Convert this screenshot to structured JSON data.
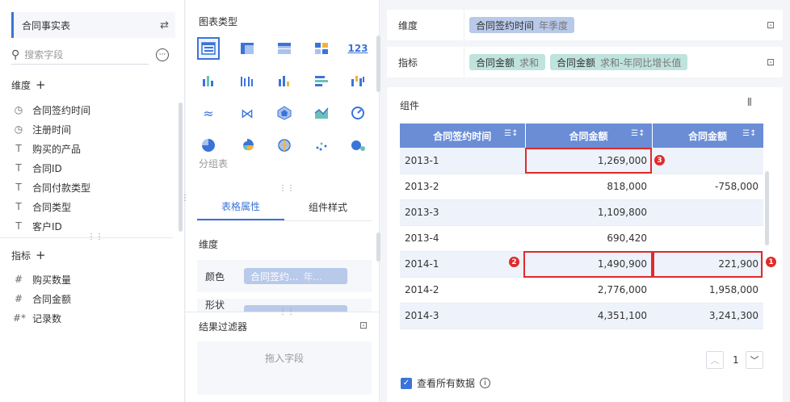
{
  "left": {
    "dataset": "合同事实表",
    "search_placeholder": "搜索字段",
    "dim_title": "维度",
    "dims": [
      {
        "icon": "clock-icon",
        "glyph": "◷",
        "label": "合同签约时间"
      },
      {
        "icon": "clock-icon",
        "glyph": "◷",
        "label": "注册时间"
      },
      {
        "icon": "text-type-icon",
        "glyph": "T",
        "label": "购买的产品"
      },
      {
        "icon": "text-type-icon",
        "glyph": "T",
        "label": "合同ID"
      },
      {
        "icon": "text-type-icon",
        "glyph": "T",
        "label": "合同付款类型"
      },
      {
        "icon": "text-type-icon",
        "glyph": "T",
        "label": "合同类型"
      },
      {
        "icon": "text-type-icon",
        "glyph": "T",
        "label": "客户ID"
      }
    ],
    "measure_title": "指标",
    "measures": [
      {
        "icon": "hash-icon",
        "glyph": "#",
        "label": "购买数量"
      },
      {
        "icon": "hash-icon",
        "glyph": "#",
        "label": "合同金额"
      },
      {
        "icon": "hash-star-icon",
        "glyph": "#*",
        "label": "记录数"
      }
    ]
  },
  "mid": {
    "chart_type_title": "图表类型",
    "group_label": "分组表",
    "tabs": [
      "表格属性",
      "组件样式"
    ],
    "dim_title": "维度",
    "color_label": "颜色",
    "color_pill": "合同签约...",
    "color_pill_sub": "年...",
    "shape_label": "形状",
    "filter_title": "结果过滤器",
    "drop_hint": "拖入字段"
  },
  "right": {
    "dim_label": "维度",
    "dim_pill": "合同签约时间",
    "dim_pill_sub": "年季度",
    "measure_label": "指标",
    "measure_pills": [
      {
        "name": "合同金额",
        "sub": "求和"
      },
      {
        "name": "合同金额",
        "sub": "求和-年同比增长值"
      }
    ],
    "component_title": "组件",
    "table": {
      "headers": [
        "合同签约时间",
        "合同金额",
        "合同金额"
      ],
      "rows": [
        [
          "2013-1",
          "1,269,000",
          ""
        ],
        [
          "2013-2",
          "818,000",
          "-758,000"
        ],
        [
          "2013-3",
          "1,109,800",
          ""
        ],
        [
          "2013-4",
          "690,420",
          ""
        ],
        [
          "2014-1",
          "1,490,900",
          "221,900"
        ],
        [
          "2014-2",
          "2,776,000",
          "1,958,000"
        ],
        [
          "2014-3",
          "4,351,100",
          "3,241,300"
        ]
      ]
    },
    "badges": [
      "1",
      "2",
      "3"
    ],
    "page": "1",
    "show_all_label": "查看所有数据"
  }
}
